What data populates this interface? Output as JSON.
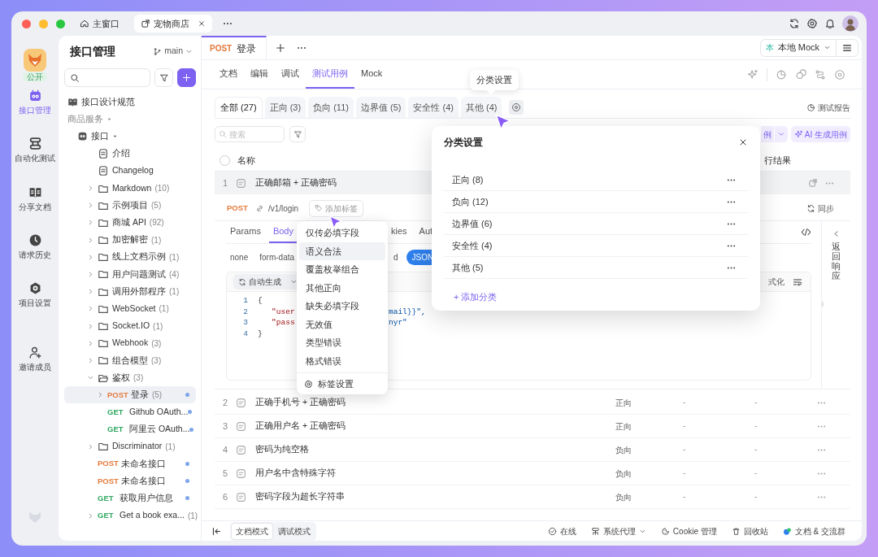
{
  "window": {
    "tabs": [
      {
        "label": "主窗口",
        "selected": false,
        "closable": false
      },
      {
        "label": "宠物商店",
        "selected": true,
        "closable": true
      }
    ]
  },
  "rail": {
    "badge": "公开",
    "items": [
      {
        "label": "接口管理",
        "selected": true
      },
      {
        "label": "自动化测试",
        "selected": false
      },
      {
        "label": "分享文档",
        "selected": false
      },
      {
        "label": "请求历史",
        "selected": false
      },
      {
        "label": "项目设置",
        "selected": false
      },
      {
        "label": "邀请成员",
        "selected": false
      }
    ]
  },
  "sidebar": {
    "title": "接口管理",
    "branch": "main",
    "tree": [
      {
        "kind": "spec",
        "label": "接口设计规范",
        "selected": false
      },
      {
        "kind": "group",
        "label": "商品服务",
        "expanded": true,
        "selected": false,
        "children": [
          {
            "kind": "module",
            "label": "接口",
            "expanded": true,
            "selected": false,
            "children": [
              {
                "kind": "doc",
                "label": "介绍",
                "selected": false
              },
              {
                "kind": "doc",
                "label": "Changelog",
                "selected": false
              },
              {
                "kind": "folder",
                "label": "Markdown",
                "count": "(10)",
                "expanded": false,
                "selected": false
              },
              {
                "kind": "folder",
                "label": "示例项目",
                "count": "(5)",
                "expanded": false,
                "selected": false
              },
              {
                "kind": "folder",
                "label": "商城 API",
                "count": "(92)",
                "expanded": false,
                "selected": false
              },
              {
                "kind": "folder",
                "label": "加密解密",
                "count": "(1)",
                "expanded": false,
                "selected": false
              },
              {
                "kind": "folder",
                "label": "线上文档示例",
                "count": "(1)",
                "expanded": false,
                "selected": false
              },
              {
                "kind": "folder",
                "label": "用户问题测试",
                "count": "(4)",
                "expanded": false,
                "selected": false
              },
              {
                "kind": "folder",
                "label": "调用外部程序",
                "count": "(1)",
                "expanded": false,
                "selected": false
              },
              {
                "kind": "folder",
                "label": "WebSocket",
                "count": "(1)",
                "expanded": false,
                "selected": false
              },
              {
                "kind": "folder",
                "label": "Socket.IO",
                "count": "(1)",
                "expanded": false,
                "selected": false
              },
              {
                "kind": "folder",
                "label": "Webhook",
                "count": "(3)",
                "expanded": false,
                "selected": false
              },
              {
                "kind": "folder",
                "label": "组合模型",
                "count": "(3)",
                "expanded": false,
                "selected": false
              },
              {
                "kind": "folder",
                "label": "鉴权",
                "count": "(3)",
                "expanded": true,
                "selected": false,
                "children": [
                  {
                    "kind": "api",
                    "method": "POST",
                    "label": "登录",
                    "count": "(5)",
                    "expanded": false,
                    "selected": true,
                    "dot": true
                  },
                  {
                    "kind": "api",
                    "method": "GET",
                    "label": "Github OAuth...",
                    "selected": false,
                    "dot": true
                  },
                  {
                    "kind": "api",
                    "method": "GET",
                    "label": "阿里云 OAuth...",
                    "selected": false,
                    "dot": true
                  }
                ]
              },
              {
                "kind": "folder",
                "label": "Discriminator",
                "count": "(1)",
                "expanded": false,
                "selected": false
              },
              {
                "kind": "api",
                "method": "POST",
                "label": "未命名接口",
                "selected": false,
                "dot": true
              },
              {
                "kind": "api",
                "method": "POST",
                "label": "未命名接口",
                "selected": false,
                "dot": true
              },
              {
                "kind": "api",
                "method": "GET",
                "label": "获取用户信息",
                "selected": false,
                "dot": true
              },
              {
                "kind": "api",
                "method": "GET",
                "label": "Get a book exa...",
                "count": "(1)",
                "expanded": false,
                "selected": false,
                "dot": false
              }
            ]
          }
        ]
      }
    ]
  },
  "request_tabs": [
    {
      "method": "POST",
      "label": "登录",
      "selected": true
    }
  ],
  "environment": {
    "badge": "本",
    "label": "本地 Mock"
  },
  "view_tabs": [
    {
      "label": "文档",
      "selected": false
    },
    {
      "label": "编辑",
      "selected": false
    },
    {
      "label": "调试",
      "selected": false
    },
    {
      "label": "测试用例",
      "selected": true
    },
    {
      "label": "Mock",
      "selected": false
    }
  ],
  "category_tabs": [
    {
      "label": "全部 (27)",
      "selected": true
    },
    {
      "label": "正向 (3)",
      "selected": false
    },
    {
      "label": "负向 (11)",
      "selected": false
    },
    {
      "label": "边界值 (5)",
      "selected": false
    },
    {
      "label": "安全性 (4)",
      "selected": false
    },
    {
      "label": "其他 (4)",
      "selected": false
    }
  ],
  "tooltip": "分类设置",
  "report_button": "测试报告",
  "case_search": {
    "placeholder": "搜索"
  },
  "new_case_button": "例",
  "ai_button": "AI 生成用例",
  "table": {
    "select_all": {
      "checked": false
    },
    "columns": [
      {
        "label": "名称"
      },
      {
        "label": "行结果"
      }
    ],
    "rows": [
      {
        "index": "1",
        "name": "正确邮箱 + 正确密码",
        "selected": true,
        "expanded": true
      },
      {
        "index": "2",
        "name": "正确手机号 + 正确密码",
        "category": "正向",
        "column_4": "-",
        "column_5": "-",
        "selected": false
      },
      {
        "index": "3",
        "name": "正确用户名 + 正确密码",
        "category": "正向",
        "column_4": "-",
        "column_5": "-",
        "selected": false
      },
      {
        "index": "4",
        "name": "密码为纯空格",
        "category": "负向",
        "column_4": "-",
        "column_5": "-",
        "selected": false
      },
      {
        "index": "5",
        "name": "用户名中含特殊字符",
        "category": "负向",
        "column_4": "-",
        "column_5": "-",
        "selected": false
      },
      {
        "index": "6",
        "name": "密码字段为超长字符串",
        "category": "负向",
        "column_4": "-",
        "column_5": "-",
        "selected": false
      }
    ]
  },
  "case_detail": {
    "method": "POST",
    "path": "/v1/login",
    "tag_button": "添加标签",
    "sync_button": "同步",
    "param_tabs": [
      {
        "label": "Params",
        "selected": false
      },
      {
        "label": "Body",
        "selected": true
      },
      {
        "label": "kies",
        "selected": false
      },
      {
        "label": "Aut",
        "selected": false
      }
    ],
    "body_types": [
      {
        "label": "none",
        "selected": false
      },
      {
        "label": "form-data",
        "selected": false
      },
      {
        "label": "d",
        "selected": false
      },
      {
        "label": "JSON",
        "selected": true
      }
    ],
    "generate_button": "自动生成",
    "format_button": "式化",
    "code": [
      {
        "number": "1",
        "left": "{"
      },
      {
        "number": "2",
        "left": "   \"user",
        "right": "mail}}\","
      },
      {
        "number": "3",
        "left": "   \"pass",
        "right": "nyr\""
      },
      {
        "number": "4",
        "left": "}"
      }
    ],
    "response_panel": "返回响应"
  },
  "mode_tabs": [
    {
      "label": "文档模式",
      "selected": true
    },
    {
      "label": "调试模式",
      "selected": false
    }
  ],
  "status_bar": [
    {
      "label": "在线",
      "dropdown": false
    },
    {
      "label": "系统代理",
      "dropdown": true
    },
    {
      "label": "Cookie 管理",
      "dropdown": false
    },
    {
      "label": "回收站",
      "dropdown": false
    },
    {
      "label": "文档 & 交流群",
      "dropdown": false
    }
  ],
  "category_popover": {
    "title": "分类设置",
    "items": [
      {
        "label": "正向 (8)"
      },
      {
        "label": "负向 (12)"
      },
      {
        "label": "边界值 (6)"
      },
      {
        "label": "安全性 (4)"
      },
      {
        "label": "其他 (5)"
      }
    ],
    "add_button": "+ 添加分类"
  },
  "tag_menu": {
    "items": [
      {
        "label": "仅传必填字段",
        "highlighted": false
      },
      {
        "label": "语义合法",
        "highlighted": true
      },
      {
        "label": "覆盖枚举组合",
        "highlighted": false
      },
      {
        "label": "其他正向",
        "highlighted": false
      },
      {
        "label": "缺失必填字段",
        "highlighted": false
      },
      {
        "label": "无效值",
        "highlighted": false
      },
      {
        "label": "类型错误",
        "highlighted": false
      },
      {
        "label": "格式错误",
        "highlighted": false
      }
    ],
    "footer": "标签设置"
  }
}
